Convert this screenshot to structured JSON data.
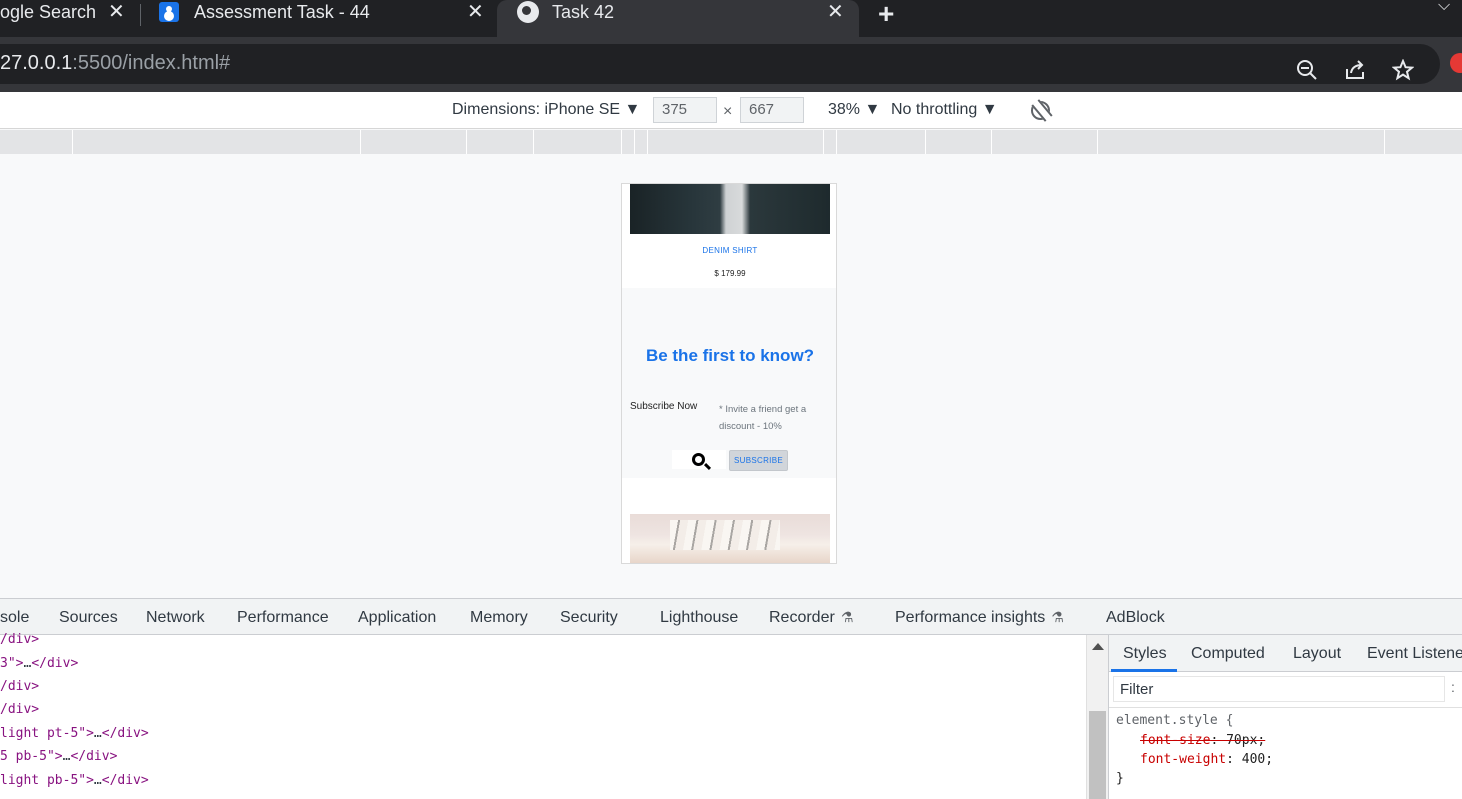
{
  "browser": {
    "tabs": [
      {
        "title": "ogle Search",
        "close": "✕"
      },
      {
        "title": "Assessment Task - 44",
        "close": "✕"
      },
      {
        "title": "Task 42",
        "close": "✕"
      }
    ],
    "new_tab": "+",
    "tab_menu": "⌵",
    "url_host": "27.0.0.1",
    "url_path": ":5500/index.html#"
  },
  "device_toolbar": {
    "dimensions": "Dimensions: iPhone SE ▼",
    "width": "375",
    "times": "×",
    "height": "667",
    "zoom": "38% ▼",
    "throttle": "No throttling ▼"
  },
  "page": {
    "product_name": "DENIM SHIRT",
    "product_price": "$ 179.99",
    "newsletter_title": "Be the first to know?",
    "subscribe_text": "Subscribe Now",
    "note": "* Invite a friend get a discount - 10%",
    "subscribe_button": "SUBSCRIBE"
  },
  "devtools": {
    "tabs": [
      "sole",
      "Sources",
      "Network",
      "Performance",
      "Application",
      "Memory",
      "Security",
      "Lighthouse",
      "Recorder",
      "Performance insights",
      "AdBlock"
    ],
    "code_lines": [
      {
        "pre": "/div>",
        "attr": "",
        "post": ""
      },
      {
        "pre": "3\">",
        "attr": "…",
        "post": "</div>"
      },
      {
        "pre": "/div>",
        "attr": "",
        "post": ""
      },
      {
        "pre": "/div>",
        "attr": "",
        "post": ""
      },
      {
        "pre": "light pt-5\">",
        "attr": "…",
        "post": "</div>"
      },
      {
        "pre": "5 pb-5\">",
        "attr": "…",
        "post": "</div>"
      },
      {
        "pre": "light pb-5\">",
        "attr": "…",
        "post": "</div>"
      }
    ],
    "styles_tabs": [
      "Styles",
      "Computed",
      "Layout",
      "Event Listene"
    ],
    "filter_placeholder": "Filter",
    "filter_colon": ":",
    "rule_selector": "element.style {",
    "rule_prop1_name": "font-size",
    "rule_prop1_value": ": 70px;",
    "rule_prop2_name": "font-weight",
    "rule_prop2_value": ": 400;",
    "rule_close": "}"
  },
  "icons": {
    "zoom": "zoom-out-icon",
    "share": "share-icon",
    "star": "star-icon",
    "rotate": "rotate-icon",
    "search": "search-icon"
  },
  "colors": {
    "accent": "#1a73e8",
    "tabstrip": "#202124",
    "active_tab": "#35363a"
  }
}
